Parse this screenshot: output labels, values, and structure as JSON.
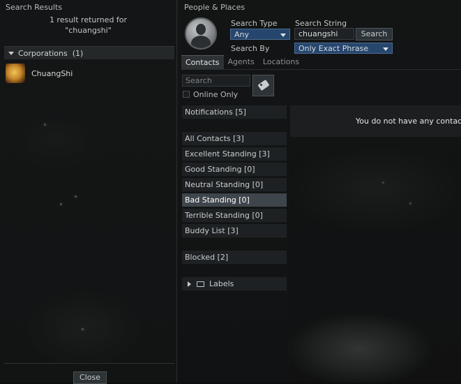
{
  "left": {
    "title": "Search Results",
    "result_line1": "1 result returned for",
    "result_line2": "\"chuangshi\"",
    "group_label": "Corporations",
    "group_count": "(1)",
    "result_name": "ChuangShi",
    "close_label": "Close"
  },
  "right": {
    "title": "People & Places",
    "search_type_label": "Search Type",
    "search_type_value": "Any",
    "search_string_label": "Search String",
    "search_string_value": "chuangshi",
    "search_button": "Search",
    "search_by_label": "Search By",
    "search_by_value": "Only Exact Phrase",
    "tabs": [
      "Contacts",
      "Agents",
      "Locations"
    ],
    "contacts_search_placeholder": "Search",
    "online_only_label": "Online Only",
    "online_only_checked": false,
    "notifications": "Notifications  [5]",
    "groups": [
      "All Contacts  [3]",
      "Excellent Standing  [3]",
      "Good Standing  [0]",
      "Neutral Standing  [0]",
      "Bad Standing  [0]",
      "Terrible Standing  [0]",
      "Buddy List  [3]"
    ],
    "selected_group": "Bad Standing  [0]",
    "blocked": "Blocked  [2]",
    "labels": "Labels",
    "empty_message": "You do not have any contacts"
  },
  "icons": {
    "portrait": "person-silhouette-icon",
    "label_tag": "tag-icon",
    "corporation_logo": "dragon-emblem-icon"
  }
}
